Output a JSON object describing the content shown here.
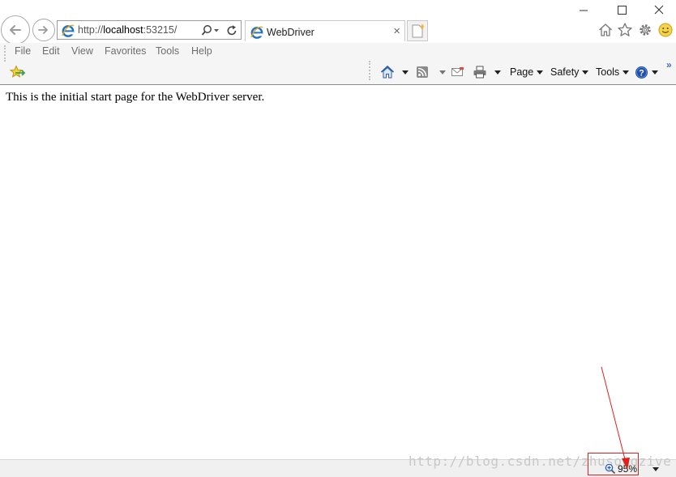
{
  "window": {
    "minimize_icon": "minimize-icon",
    "maximize_icon": "maximize-icon",
    "close_icon": "close-icon"
  },
  "navigation": {
    "back_icon": "back-arrow-icon",
    "forward_icon": "forward-arrow-icon",
    "address": {
      "prefix": "http://",
      "host": "localhost",
      "port_path": ":53215/"
    }
  },
  "tab": {
    "title": "WebDriver",
    "close_glyph": "×"
  },
  "menu": {
    "items": [
      "File",
      "Edit",
      "View",
      "Favorites",
      "Tools",
      "Help"
    ]
  },
  "commandbar": {
    "page_label": "Page",
    "safety_label": "Safety",
    "tools_label": "Tools",
    "chevron": "»"
  },
  "content": {
    "message": "This is the initial start page for the WebDriver server."
  },
  "status": {
    "zoom_level": "95%",
    "watermark": "http://blog.csdn.net/zhusongzive"
  },
  "colors": {
    "annotation": "#e0201c",
    "ie_blue": "#1e73c8",
    "accent": "#3a6fc4"
  }
}
